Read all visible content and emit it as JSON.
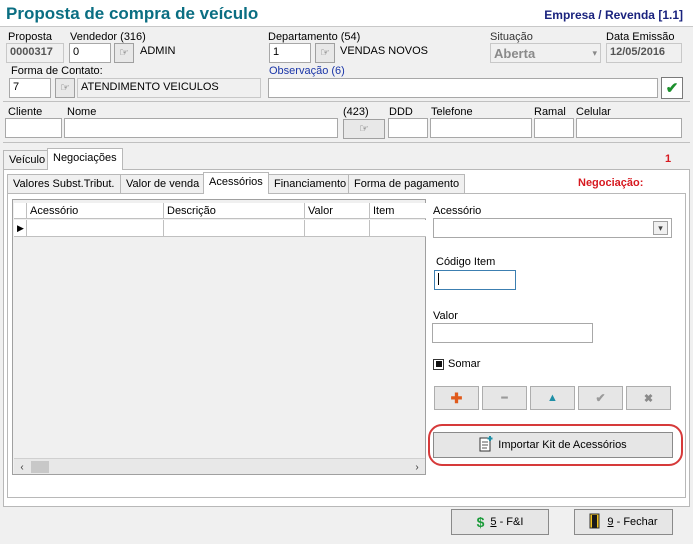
{
  "header": {
    "title": "Proposta de compra de veículo",
    "company": "Empresa / Revenda [1.1]"
  },
  "form": {
    "proposta": {
      "label": "Proposta",
      "value": "0000317"
    },
    "vendedor": {
      "label": "Vendedor (316)",
      "code": "0",
      "name": "ADMIN"
    },
    "departamento": {
      "label": "Departamento (54)",
      "code": "1",
      "name": "VENDAS NOVOS"
    },
    "situacao": {
      "label": "Situação",
      "value": "Aberta"
    },
    "data_emissao": {
      "label": "Data Emissão",
      "value": "12/05/2016"
    },
    "forma_contato": {
      "label": "Forma de Contato:",
      "code": "7",
      "name": "ATENDIMENTO VEICULOS"
    },
    "observacao": {
      "label": "Observação (6)",
      "value": ""
    }
  },
  "cliente": {
    "labels": {
      "cliente": "Cliente",
      "nome": "Nome",
      "count": "(423)",
      "ddd": "DDD",
      "telefone": "Telefone",
      "ramal": "Ramal",
      "celular": "Celular"
    }
  },
  "main_tabs": [
    {
      "label": "Veículo"
    },
    {
      "label": "Negociações"
    }
  ],
  "negociacao_count": "1",
  "sub_tabs": [
    {
      "label": "Valores Subst.Tribut."
    },
    {
      "label": "Valor de venda"
    },
    {
      "label": "Acessórios"
    },
    {
      "label": "Financiamento"
    },
    {
      "label": "Forma de pagamento"
    }
  ],
  "negociacao_label": "Negociação:",
  "grid": {
    "columns": [
      "Acessório",
      "Descrição",
      "Valor",
      "Item"
    ],
    "row_indicator": "▶"
  },
  "right_panel": {
    "acessorio_label": "Acessório",
    "acessorio_value": "",
    "codigo_item_label": "Código Item",
    "codigo_item_value": "",
    "valor_label": "Valor",
    "valor_value": "",
    "somar_label": "Somar"
  },
  "action_buttons": {
    "add": "✚",
    "remove": "━",
    "up": "▲",
    "confirm": "✔",
    "cancel": "✖"
  },
  "kit_button": {
    "label": "Importar Kit de Acessórios"
  },
  "footer": {
    "fi_key": "5",
    "fi_label": " - F&I",
    "close_key": "9",
    "close_label": " - Fechar"
  },
  "colors": {
    "title": "#0a6e82",
    "company": "#1a237e",
    "accent_red": "#d71920",
    "highlight_ring": "#d63a3a"
  }
}
